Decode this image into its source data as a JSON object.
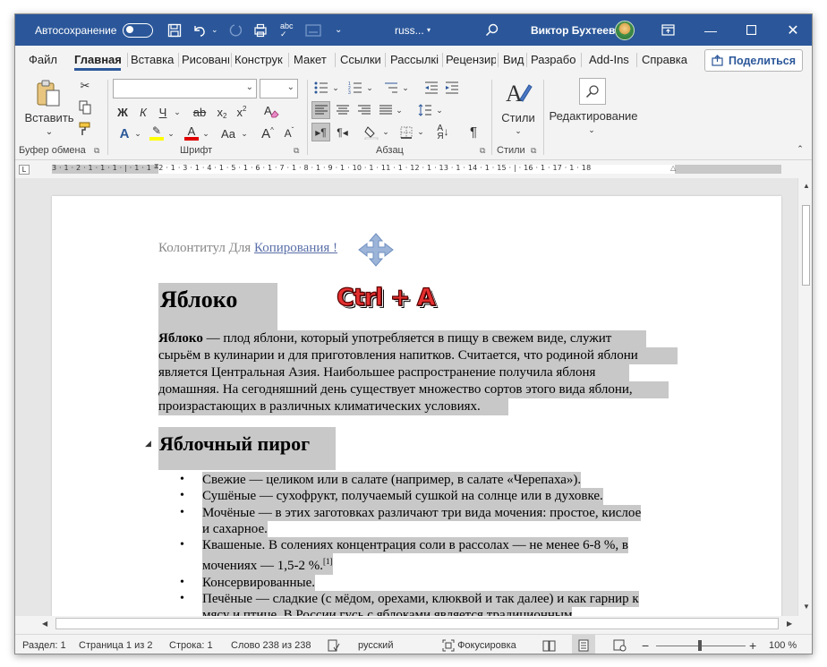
{
  "titlebar": {
    "autosave_label": "Автосохранение",
    "doc_name": "russ...",
    "user_name": "Виктор Бухтеев",
    "icons": [
      "save-icon",
      "undo-icon",
      "redo-icon",
      "print-preview-icon",
      "spelling-icon",
      "mailings-icon",
      "more-icon",
      "search-icon",
      "ribbon-display-icon"
    ]
  },
  "menu": {
    "tabs": [
      "Файл",
      "Главная",
      "Вставка",
      "Рисовани",
      "Конструк",
      "Макет",
      "Ссылки",
      "Рассылкі",
      "Рецензир",
      "Вид",
      "Разрабо",
      "Add-Ins",
      "Справка"
    ],
    "active_tab": "Главная",
    "share_label": "Поделиться"
  },
  "ribbon": {
    "clipboard": {
      "paste_label": "Вставить",
      "group_label": "Буфер обмена"
    },
    "font": {
      "font_name": "",
      "font_size": "",
      "bold": "Ж",
      "italic": "К",
      "underline": "Ч",
      "strike": "ab",
      "subscript": "x",
      "superscript": "x",
      "change_case": "Aa",
      "grow": "A",
      "shrink": "A",
      "group_label": "Шрифт"
    },
    "paragraph": {
      "group_label": "Абзац"
    },
    "styles": {
      "label": "Стили",
      "group_label": "Стили"
    },
    "editing": {
      "label": "Редактирование"
    },
    "colors": {
      "accent": "#2b579a",
      "highlight": "#ffff00",
      "font_color": "#e00000"
    }
  },
  "ruler": {
    "numbers": "3 · 1 · 2 · 1 · 1 · 1 · | · 1 · 1 · 2 · 1 · 3 · 1 · 4 · 1 · 5 · 1 · 6 · 1 · 7 · 1 · 8 · 1 · 9 · 1 · 10 · 1 · 11 · 1 · 12 · 1 · 13 · 1 · 14 · 1 · 15 · | · 16 · 1 · 17 · 1 · 18"
  },
  "document": {
    "header_prefix": "Колонтитул Для ",
    "header_link": "Копирования !",
    "heading1": "Яблоко",
    "overlay_text": "Ctrl + A",
    "para_bold": "Яблоко",
    "para_lines": [
      " — плод яблони, который употребляется в пищу в свежем виде, служит",
      "сырьём в кулинарии и для приготовления напитков. Считается, что родиной яблони",
      "является Центральная Азия. Наибольшее распространение получила яблоня",
      "домашняя. На сегодняшний день существует множество сортов этого вида яблони,",
      "произрастающих в различных климатических условиях."
    ],
    "heading2": "Яблочный пирог",
    "list_items": [
      [
        "Свежие — целиком или в салате (например, в салате «Черепаха»)."
      ],
      [
        "Сушёные — сухофрукт, получаемый сушкой на солнце или в духовке."
      ],
      [
        "Мочёные — в этих заготовках различают три вида мочения: простое, кислое",
        "и сахарное."
      ],
      [
        "Квашеные. В солениях концентрация соли в рассолах — не менее 6-8 %, в",
        "мочениях — 1,5-2 %."
      ],
      [
        "Консервированные."
      ],
      [
        "Печёные — сладкие (с мёдом, орехами, клюквой и так далее) и как гарнир к",
        "мясу и птице. В России гусь с яблоками является традиционным"
      ]
    ],
    "footnote": "[1]"
  },
  "status": {
    "section": "Раздел: 1",
    "page": "Страница 1 из 2",
    "line": "Строка: 1",
    "words": "Слово 238 из 238",
    "language": "русский",
    "focus": "Фокусировка",
    "zoom": "100 %",
    "zoom_minus": "−",
    "zoom_plus": "+"
  }
}
